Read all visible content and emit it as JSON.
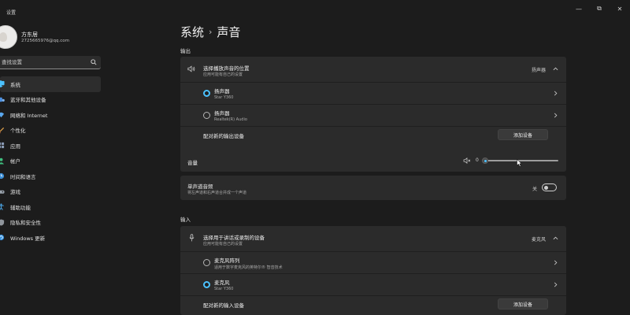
{
  "window": {
    "title": "设置",
    "minimize": "—",
    "maximize": "⧉",
    "close": "✕"
  },
  "profile": {
    "name": "方东居",
    "email": "2725665976@qq.com"
  },
  "search": {
    "placeholder": "查找设置"
  },
  "nav": [
    {
      "label": "系统",
      "icon": "monitor-icon",
      "active": true
    },
    {
      "label": "蓝牙和其他设备",
      "icon": "bluetooth-icon"
    },
    {
      "label": "网络和 Internet",
      "icon": "wifi-icon"
    },
    {
      "label": "个性化",
      "icon": "brush-icon"
    },
    {
      "label": "应用",
      "icon": "apps-icon"
    },
    {
      "label": "帐户",
      "icon": "person-icon"
    },
    {
      "label": "时间和语言",
      "icon": "globe-clock-icon"
    },
    {
      "label": "游戏",
      "icon": "gamepad-icon"
    },
    {
      "label": "辅助功能",
      "icon": "accessibility-icon"
    },
    {
      "label": "隐私和安全性",
      "icon": "shield-icon"
    },
    {
      "label": "Windows 更新",
      "icon": "update-icon"
    }
  ],
  "breadcrumb": {
    "parent": "系统",
    "separator": "›",
    "current": "声音"
  },
  "output": {
    "section_label": "输出",
    "choose": {
      "title": "选择播放声音的位置",
      "subtitle": "应用可能有自己的设置",
      "value": "扬声器"
    },
    "devices": [
      {
        "name": "扬声器",
        "detail": "Star Y360",
        "selected": true
      },
      {
        "name": "扬声器",
        "detail": "Realtek(R) Audio",
        "selected": false
      }
    ],
    "pair": {
      "label": "配对新的输出设备",
      "button": "添加设备"
    },
    "volume": {
      "label": "音量",
      "value": "0",
      "level": 0
    },
    "mono": {
      "title": "单声道音频",
      "subtitle": "将左声道和右声道合并成一个声道",
      "state": "关"
    }
  },
  "input": {
    "section_label": "输入",
    "choose": {
      "title": "选择用于讲话或录制的设备",
      "subtitle": "应用可能有自己的设置",
      "value": "麦克风"
    },
    "devices": [
      {
        "name": "麦克风阵列",
        "detail": "适用于数字麦克风的英特尔® 智音技术",
        "selected": false
      },
      {
        "name": "麦克风",
        "detail": "Star Y360",
        "selected": true
      }
    ],
    "pair": {
      "label": "配对新的输入设备",
      "button": "添加设备"
    }
  },
  "colors": {
    "accent": "#4cc2ff",
    "background": "#1c1c1c",
    "card": "#2b2b2b"
  }
}
